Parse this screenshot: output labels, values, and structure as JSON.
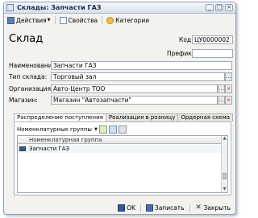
{
  "window": {
    "title": "Склады: Запчасти ГАЗ"
  },
  "toolbar": {
    "actions_label": "Действия",
    "properties_label": "Свойства",
    "categories_label": "Категории"
  },
  "form": {
    "heading": "Склад",
    "code_label": "Код:",
    "code_value": "ЦУ0000002",
    "prefix_label": "Префикс:",
    "prefix_value": "",
    "name_label": "Наименование:",
    "name_value": "Запчасти ГАЗ",
    "type_label": "Тип склада:",
    "type_value": "Торговый зал",
    "org_label": "Организация:",
    "org_value": "Авто-Центр ТОО",
    "store_label": "Магазин:",
    "store_value": "Магазин \"Автозапчасти\""
  },
  "tabs": [
    {
      "label": "Распределение поступления"
    },
    {
      "label": "Реализация в розницу"
    },
    {
      "label": "Ордерная схема"
    }
  ],
  "panel": {
    "groups_label": "Номенклатурные группы",
    "column_header": "Номенклатурная группа",
    "rows": [
      "Запчасти ГАЗ"
    ]
  },
  "footer": {
    "ok_label": "OK",
    "save_label": "Записать",
    "close_label": "Закрыть"
  }
}
